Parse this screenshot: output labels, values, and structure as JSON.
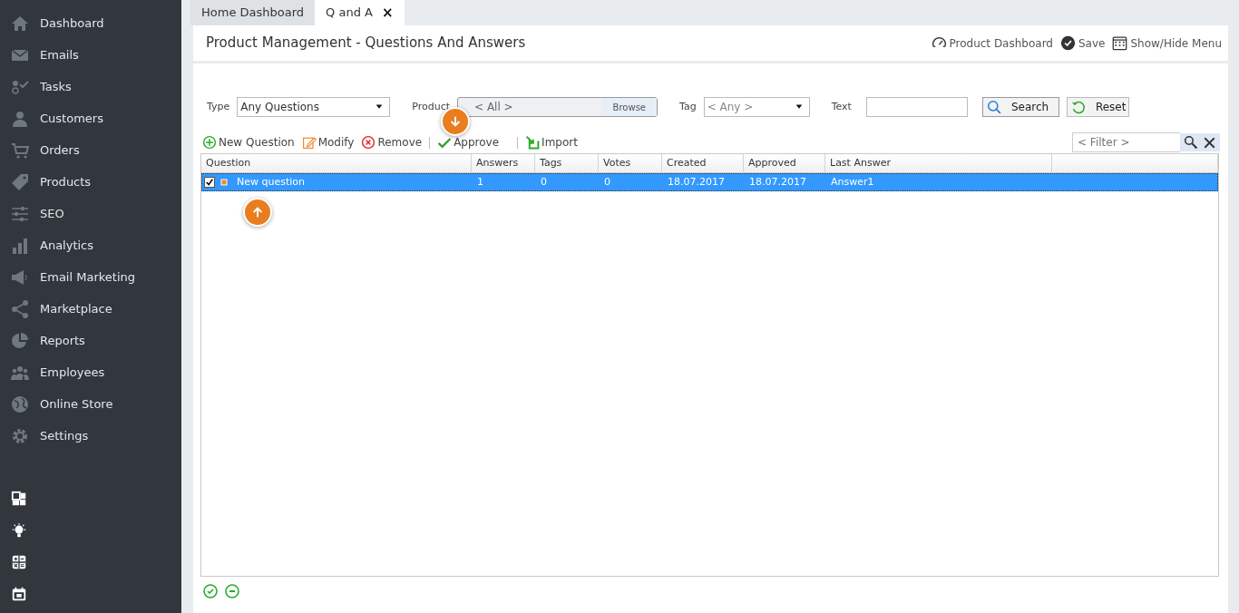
{
  "sidebar": {
    "items": [
      {
        "label": "Dashboard"
      },
      {
        "label": "Emails"
      },
      {
        "label": "Tasks"
      },
      {
        "label": "Customers"
      },
      {
        "label": "Orders"
      },
      {
        "label": "Products"
      },
      {
        "label": "SEO"
      },
      {
        "label": "Analytics"
      },
      {
        "label": "Email Marketing"
      },
      {
        "label": "Marketplace"
      },
      {
        "label": "Reports"
      },
      {
        "label": "Employees"
      },
      {
        "label": "Online Store"
      },
      {
        "label": "Settings"
      }
    ]
  },
  "tabs": [
    {
      "label": "Home Dashboard",
      "selected": false
    },
    {
      "label": "Q and A",
      "selected": true,
      "close": "×"
    }
  ],
  "page": {
    "title": "Product Management - Questions And Answers",
    "actions": [
      "Product Dashboard",
      "Save",
      "Show/Hide Menu"
    ]
  },
  "filters": {
    "type": {
      "label": "Type",
      "value": "Any Questions"
    },
    "product": {
      "label": "Product",
      "value": "< All >",
      "button": "Browse"
    },
    "tag": {
      "label": "Tag",
      "value": "< Any >"
    },
    "text": {
      "label": "Text"
    },
    "search": "Search",
    "reset": "Reset"
  },
  "toolbar": [
    "New Question",
    "Modify",
    "Remove",
    "Approve",
    "Import"
  ],
  "filter_box": {
    "placeholder": "< Filter >"
  },
  "table": {
    "columns": [
      "Question",
      "Answers",
      "Tags",
      "Votes",
      "Created",
      "Approved",
      "Last Answer"
    ],
    "rows": [
      {
        "checked": true,
        "selected": true,
        "cells": [
          "New question",
          "1",
          "0",
          "0",
          "18.07.2017",
          "18.07.2017",
          "Answer1"
        ]
      }
    ]
  }
}
